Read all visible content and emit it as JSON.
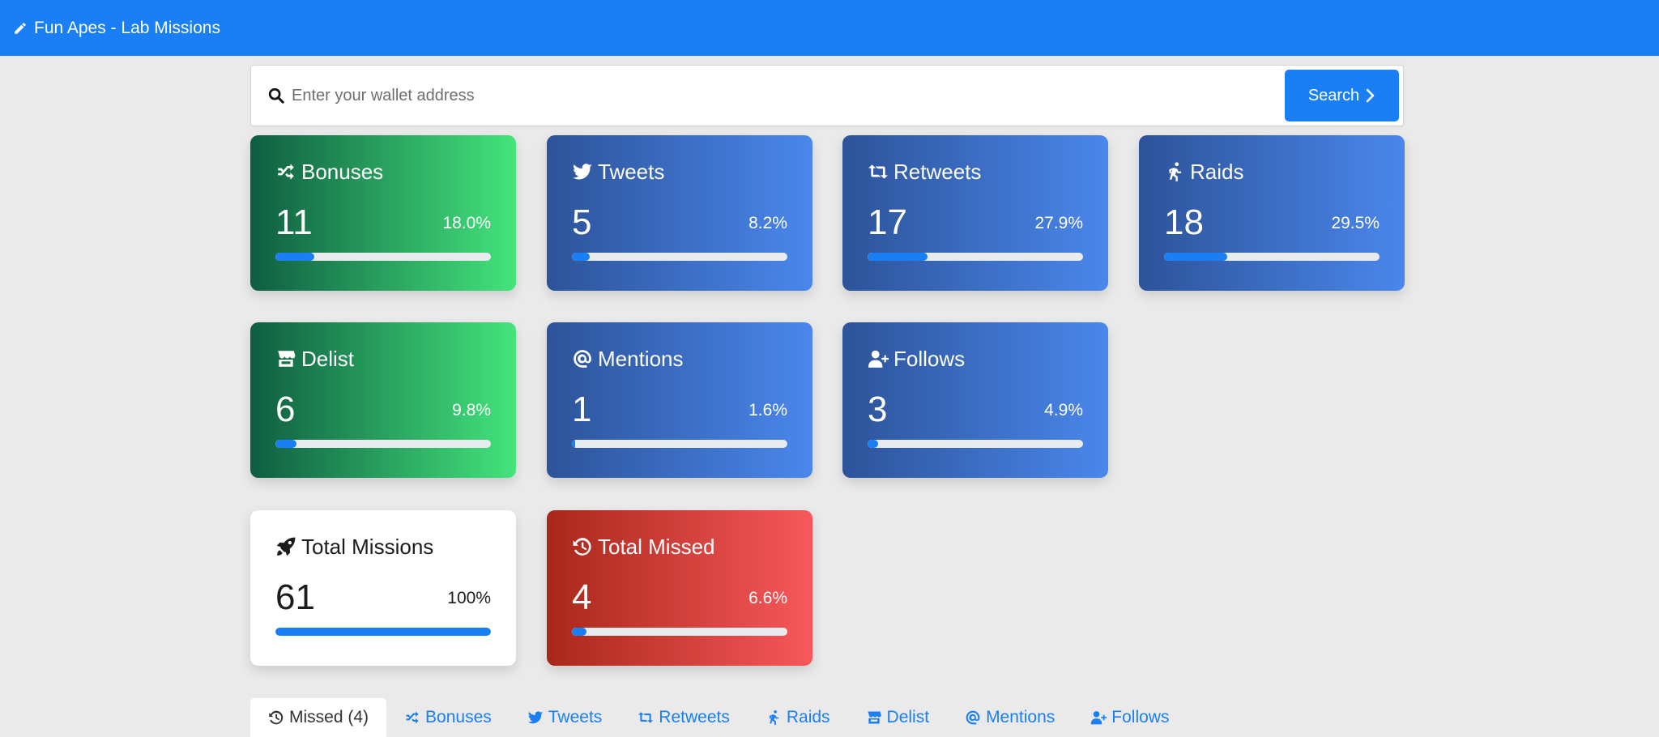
{
  "navbar": {
    "title": "Fun Apes - Lab Missions"
  },
  "search": {
    "placeholder": "Enter your wallet address",
    "button_label": "Search"
  },
  "cards": {
    "bonuses": {
      "title": "Bonuses",
      "value": "11",
      "percent": "18.0%",
      "progress": 0.18
    },
    "tweets": {
      "title": "Tweets",
      "value": "5",
      "percent": "8.2%",
      "progress": 0.082
    },
    "retweets": {
      "title": "Retweets",
      "value": "17",
      "percent": "27.9%",
      "progress": 0.279
    },
    "raids": {
      "title": "Raids",
      "value": "18",
      "percent": "29.5%",
      "progress": 0.295
    },
    "delist": {
      "title": "Delist",
      "value": "6",
      "percent": "9.8%",
      "progress": 0.098
    },
    "mentions": {
      "title": "Mentions",
      "value": "1",
      "percent": "1.6%",
      "progress": 0.016
    },
    "follows": {
      "title": "Follows",
      "value": "3",
      "percent": "4.9%",
      "progress": 0.049
    },
    "total_missions": {
      "title": "Total Missions",
      "value": "61",
      "percent": "100%",
      "progress": 1.0
    },
    "total_missed": {
      "title": "Total Missed",
      "value": "4",
      "percent": "6.6%",
      "progress": 0.066
    }
  },
  "tabs": [
    {
      "label": "Missed (4)"
    },
    {
      "label": "Bonuses"
    },
    {
      "label": "Tweets"
    },
    {
      "label": "Retweets"
    },
    {
      "label": "Raids"
    },
    {
      "label": "Delist"
    },
    {
      "label": "Mentions"
    },
    {
      "label": "Follows"
    }
  ],
  "colors": {
    "primary": "#1a7ff5",
    "green_start": "#0e5d41",
    "green_end": "#44e47c",
    "blue_start": "#2d5399",
    "blue_end": "#4a87ec",
    "red_start": "#a9271a",
    "red_end": "#f7585b"
  }
}
